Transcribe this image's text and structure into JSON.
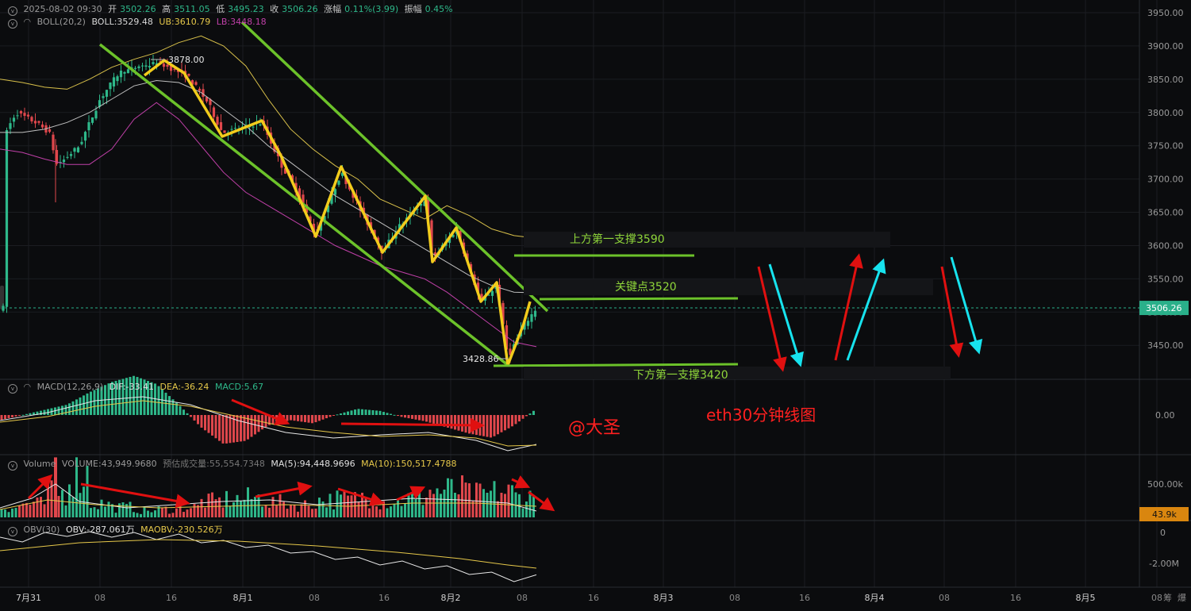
{
  "header": {
    "datetime": "2025-08-02 09:30",
    "open_label": "开",
    "open": "3502.26",
    "high_label": "高",
    "high": "3511.05",
    "low_label": "低",
    "low": "3495.23",
    "close_label": "收",
    "close": "3506.26",
    "change_label": "涨幅",
    "change": "0.11%(3.99)",
    "amp_label": "振幅",
    "amp": "0.45%"
  },
  "boll": {
    "name": "BOLL(20,2)",
    "mid": "BOLL:3529.48",
    "ub": "UB:3610.79",
    "lb": "LB:3448.18"
  },
  "macd": {
    "name": "MACD(12,26,9)",
    "dif": "DIF:-33.41",
    "dea": "DEA:-36.24",
    "macd": "MACD:5.67"
  },
  "volume": {
    "name": "Volume",
    "vol": "VOLUME:43,949.9680",
    "est": "预估成交量:55,554.7348",
    "ma5": "MA(5):94,448.9696",
    "ma10": "MA(10):150,517.4788"
  },
  "obv": {
    "name": "OBV(30)",
    "obv": "OBV:-287.061万",
    "maobv": "MAOBV:-230.526万"
  },
  "price_axis": [
    "3950.00",
    "3900.00",
    "3850.00",
    "3800.00",
    "3750.00",
    "3700.00",
    "3650.00",
    "3600.00",
    "3550.00",
    "3500.00",
    "3450.00"
  ],
  "current_price": "3506.26",
  "macd_axis": [
    "0.00"
  ],
  "vol_axis": [
    "500.00k"
  ],
  "vol_current": "43.9k",
  "obv_axis": [
    "0",
    "-2.00M"
  ],
  "time_axis": [
    "7月31",
    "08",
    "16",
    "8月1",
    "08",
    "16",
    "8月2",
    "08",
    "16",
    "8月3",
    "08",
    "16",
    "8月4",
    "08",
    "16",
    "8月5",
    "08"
  ],
  "corner_labels": [
    "筹",
    "爆"
  ],
  "annotations": {
    "high_label": "3878.00",
    "low_label": "3428.86",
    "resist": "上方第一支撑3590",
    "key": "关键点3520",
    "support": "下方第一支撑3420",
    "author": "@大圣",
    "chart_name": "eth30分钟线图"
  },
  "colors": {
    "up": "#2eb88a",
    "down": "#e0474c",
    "channel": "#6cc22a",
    "zigzag": "#f2cc1c",
    "ub": "#d8c04a",
    "lb": "#c040a8",
    "mid": "#bfbfbf",
    "arrow_red": "#e01010",
    "arrow_cyan": "#17e3ee"
  },
  "chart_data": {
    "type": "candlestick",
    "interval": "30m",
    "y_range": [
      3400,
      3960
    ],
    "price_ticks": [
      3450,
      3500,
      3550,
      3600,
      3650,
      3700,
      3750,
      3800,
      3850,
      3900,
      3950
    ],
    "series": [
      {
        "name": "BOLL",
        "values": [
          3770,
          3770,
          3775,
          3785,
          3800,
          3820,
          3840,
          3848,
          3845,
          3830,
          3805,
          3780,
          3750,
          3725,
          3700,
          3675,
          3655,
          3635,
          3615,
          3595,
          3575,
          3555,
          3540,
          3530,
          3529
        ]
      },
      {
        "name": "UB",
        "values": [
          3850,
          3845,
          3838,
          3835,
          3850,
          3868,
          3880,
          3890,
          3905,
          3915,
          3900,
          3870,
          3820,
          3775,
          3745,
          3720,
          3700,
          3670,
          3655,
          3640,
          3660,
          3645,
          3625,
          3615,
          3611
        ]
      },
      {
        "name": "LB",
        "values": [
          3745,
          3740,
          3730,
          3722,
          3722,
          3745,
          3790,
          3815,
          3790,
          3750,
          3710,
          3680,
          3660,
          3640,
          3620,
          3600,
          3585,
          3570,
          3560,
          3550,
          3530,
          3505,
          3480,
          3455,
          3448
        ]
      },
      {
        "name": "MACD",
        "values": [
          -5,
          0,
          5,
          10,
          22,
          32,
          38,
          30,
          10,
          -12,
          -28,
          -25,
          -10,
          -5,
          -8,
          0,
          6,
          4,
          -2,
          -6,
          -12,
          -18,
          -22,
          -10,
          6
        ]
      },
      {
        "name": "Volume",
        "values": [
          90,
          120,
          210,
          380,
          120,
          90,
          60,
          70,
          90,
          140,
          160,
          170,
          130,
          110,
          150,
          160,
          180,
          140,
          170,
          230,
          240,
          200,
          220,
          180,
          44
        ]
      },
      {
        "name": "OBV",
        "values": [
          -50,
          -40,
          -20,
          -5,
          -15,
          -10,
          -20,
          -25,
          -30,
          -45,
          -70,
          -75,
          -100,
          -110,
          -140,
          -150,
          -175,
          -185,
          -200,
          -210,
          -230,
          -245,
          -270,
          -290,
          -287
        ]
      }
    ],
    "key_levels": {
      "resistance": 3590,
      "key": 3520,
      "support": 3420
    },
    "price_high": 3878.0,
    "price_low": 3428.86
  }
}
